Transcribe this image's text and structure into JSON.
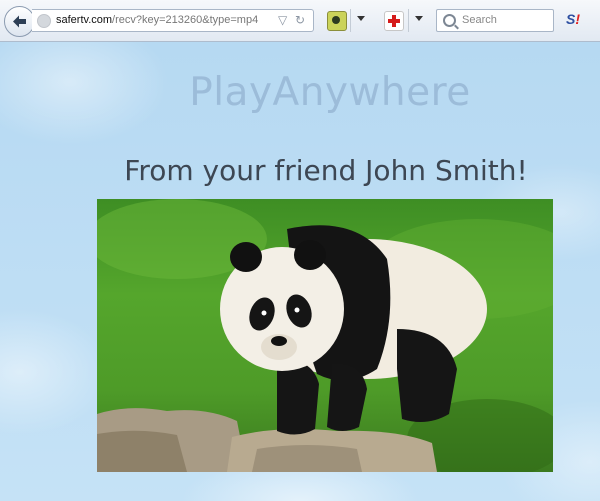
{
  "browser": {
    "url_domain": "safertv.com",
    "url_path": "/recv?key=213260&type=mp4",
    "url_ctrl_dropdown": "▽",
    "url_ctrl_reload": "↻",
    "search_placeholder": "Search",
    "ext_logo_s": "S",
    "ext_logo_bang": "!"
  },
  "page": {
    "brand": "PlayAnywhere",
    "subtitle": "From your friend John Smith!"
  }
}
